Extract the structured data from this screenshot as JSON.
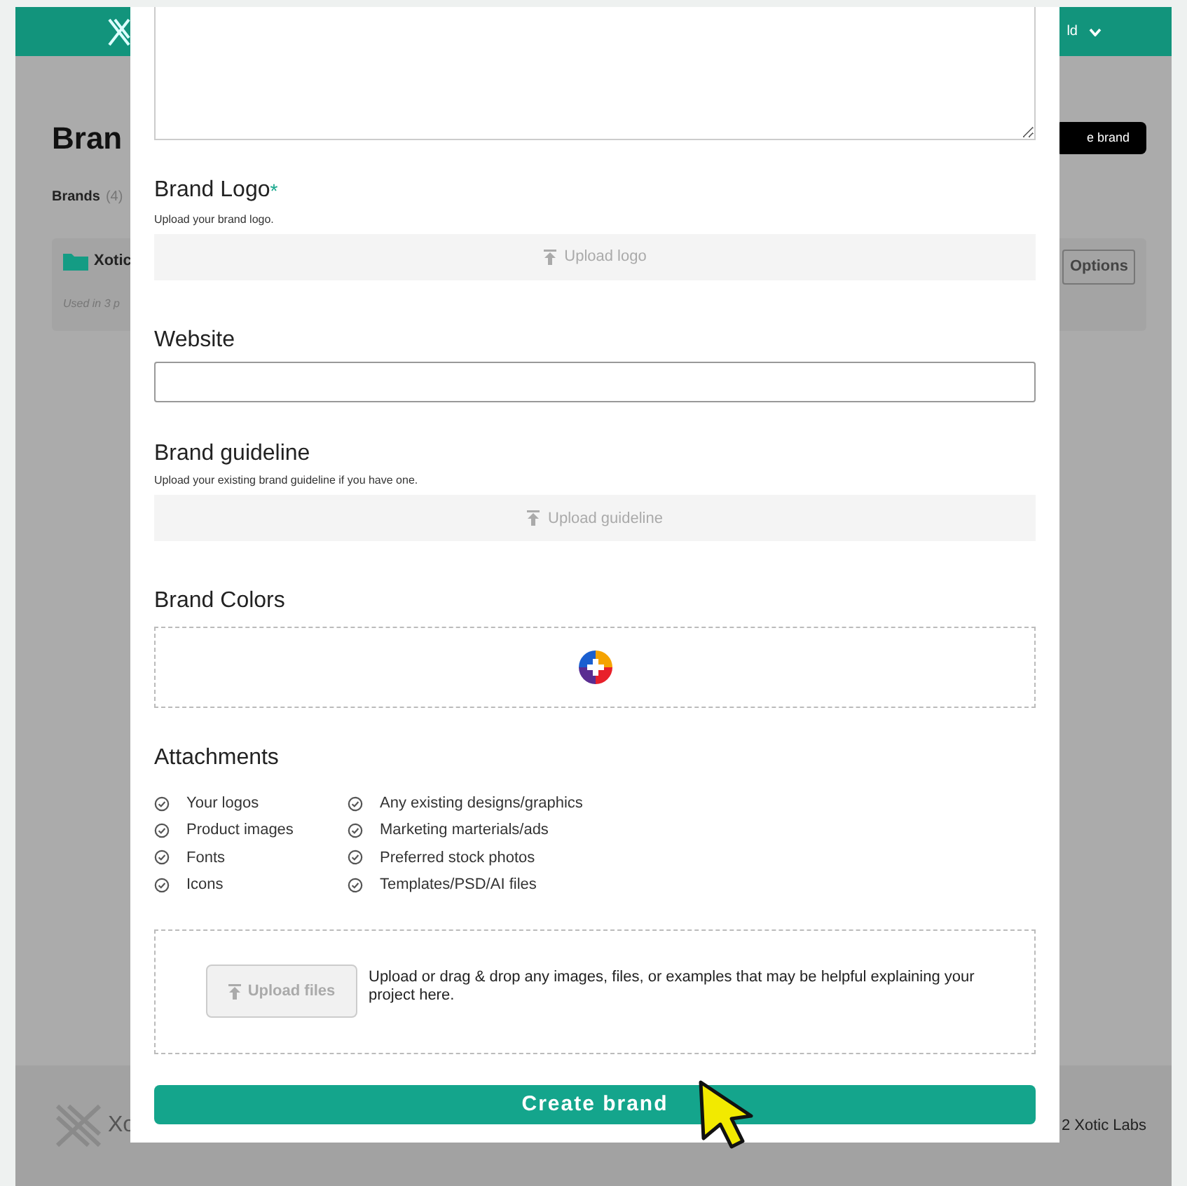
{
  "background_page": {
    "header_user": "ld",
    "title": "Bran",
    "create_button": "e brand",
    "tab_label": "Brands",
    "tab_count": "(4)",
    "brand_card": {
      "name": "Xotic",
      "usage": "Used in 3 p",
      "options_button": "Options"
    },
    "footer": {
      "logo_text": "Xo",
      "copyright": "2 Xotic Labs"
    }
  },
  "modal": {
    "sections": [
      {
        "kind": "textarea"
      },
      {
        "kind": "upload",
        "label": "Brand Logo",
        "required_mark": "*",
        "hint": "Upload your brand logo.",
        "button": "Upload logo"
      },
      {
        "kind": "input",
        "label": "Website"
      },
      {
        "kind": "upload",
        "label": "Brand guideline",
        "hint": "Upload your existing brand guideline if you have one.",
        "button": "Upload guideline"
      },
      {
        "kind": "colors",
        "label": "Brand Colors"
      },
      {
        "kind": "attachments",
        "label": "Attachments",
        "checklist": [
          [
            "Your logos",
            "Product images",
            "Fonts",
            "Icons"
          ],
          [
            "Any existing designs/graphics",
            "Marketing marterials/ads",
            "Preferred stock photos",
            "Templates/PSD/AI files"
          ]
        ],
        "upload_button": "Upload files",
        "upload_text": "Upload or drag & drop any images, files, or examples that may be helpful explaining your project here."
      }
    ],
    "submit_button": "Create brand"
  }
}
